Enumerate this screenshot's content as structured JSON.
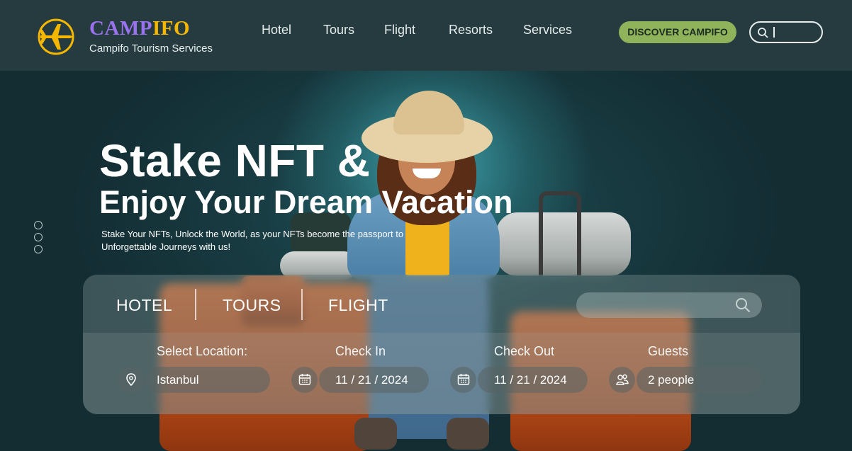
{
  "brand": {
    "name_part1": "CAMP",
    "name_part2": "IFO",
    "tagline": "Campifo Tourism Services",
    "logo_icon": "airplane-icon",
    "colors": {
      "primary": "#9a72f0",
      "accent": "#f5b700",
      "cta": "#8fb35a"
    }
  },
  "nav": {
    "items": [
      "Hotel",
      "Tours",
      "Flight",
      "Resorts",
      "Services"
    ],
    "cta_label": "DISCOVER CAMPIFO",
    "search_icon": "search-icon"
  },
  "hero": {
    "title": "Stake NFT &",
    "subtitle": "Enjoy Your Dream Vacation",
    "description": "Stake Your NFTs, Unlock the World, as your NFTs become the passport to Unforgettable Journeys with us!"
  },
  "booking": {
    "tabs": [
      "HOTEL",
      "TOURS",
      "FLIGHT"
    ],
    "search_icon": "search-icon",
    "fields": [
      {
        "label": "Select Location:",
        "value": "Istanbul",
        "icon": "location-pin-icon"
      },
      {
        "label": "Check In",
        "value": "11 / 21 / 2024",
        "icon": "calendar-icon"
      },
      {
        "label": "Check Out",
        "value": "11 / 21 / 2024",
        "icon": "calendar-icon"
      },
      {
        "label": "Guests",
        "value": "2 people",
        "icon": "people-icon"
      }
    ]
  }
}
